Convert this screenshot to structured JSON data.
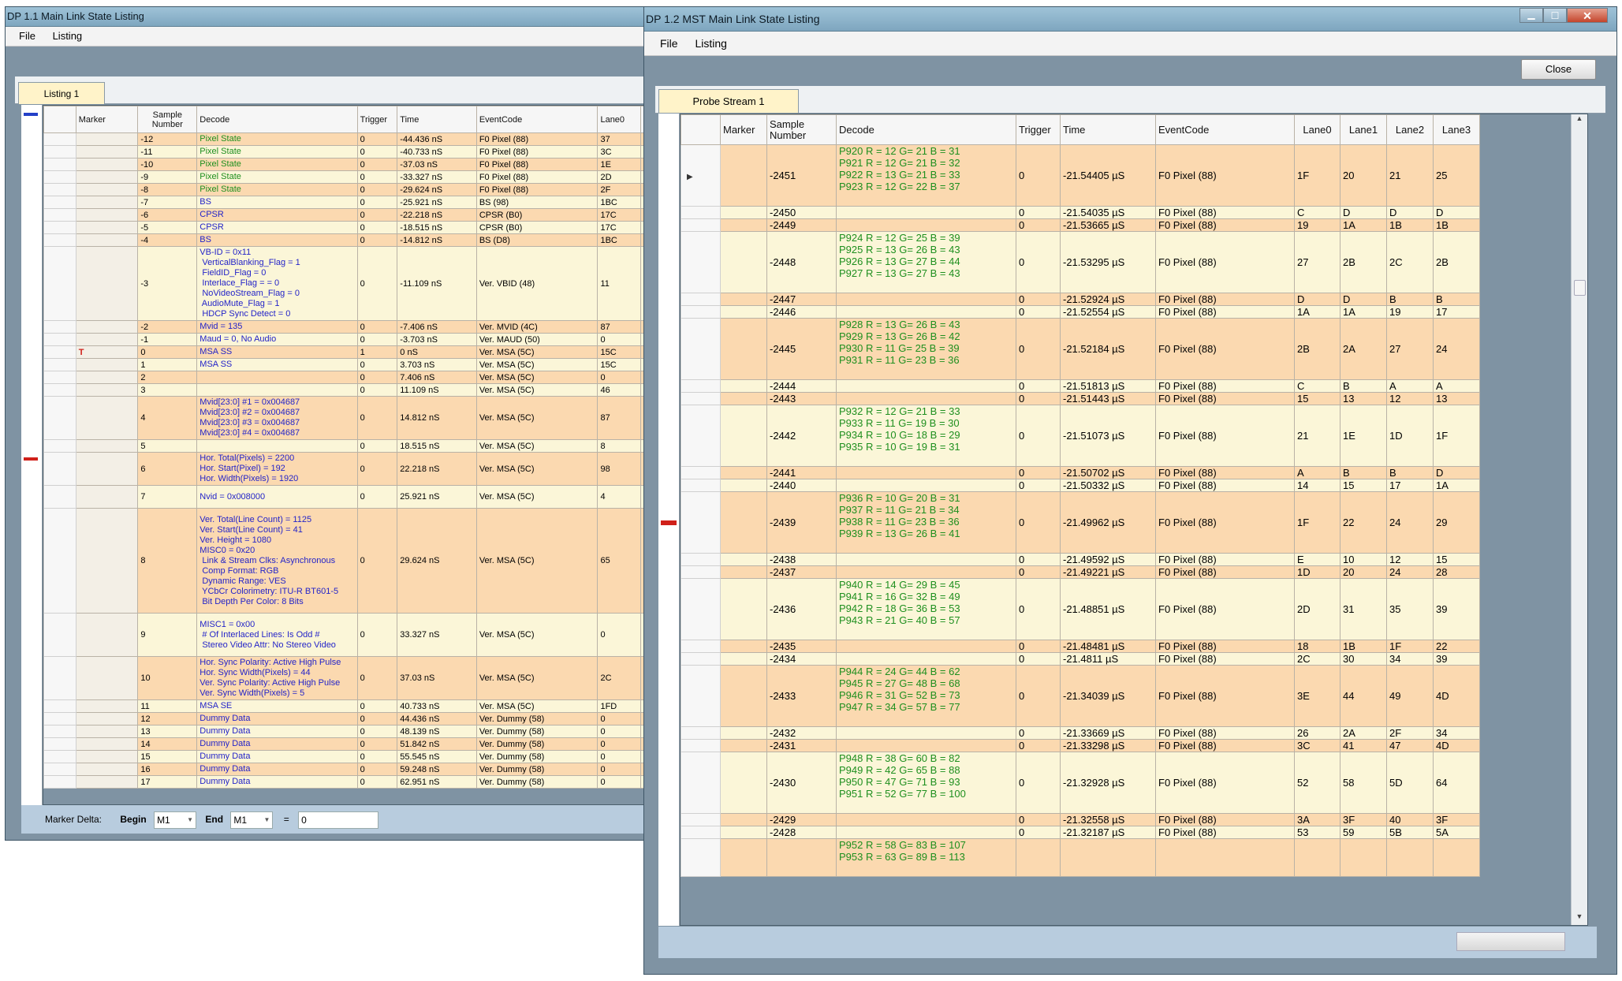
{
  "window1": {
    "title": "DP 1.1 Main Link State Listing",
    "menu": [
      "File",
      "Listing"
    ],
    "tab": "Listing 1",
    "columns": [
      "Marker",
      "Sample Number",
      "Decode",
      "Trigger",
      "Time",
      "EventCode",
      "Lane0"
    ],
    "rows": [
      {
        "marker": "",
        "sample": "-12",
        "decode": [
          "Pixel State"
        ],
        "dc": "green",
        "trigger": "0",
        "time": "-44.436 nS",
        "event": "F0 Pixel (88)",
        "lane0": "37",
        "extra": "3"
      },
      {
        "marker": "",
        "sample": "-11",
        "decode": [
          "Pixel State"
        ],
        "dc": "green",
        "trigger": "0",
        "time": "-40.733 nS",
        "event": "F0 Pixel (88)",
        "lane0": "3C",
        "extra": "3"
      },
      {
        "marker": "",
        "sample": "-10",
        "decode": [
          "Pixel State"
        ],
        "dc": "green",
        "trigger": "0",
        "time": "-37.03 nS",
        "event": "F0 Pixel (88)",
        "lane0": "1E",
        "extra": "1"
      },
      {
        "marker": "",
        "sample": "-9",
        "decode": [
          "Pixel State"
        ],
        "dc": "green",
        "trigger": "0",
        "time": "-33.327 nS",
        "event": "F0 Pixel (88)",
        "lane0": "2D",
        "extra": "2"
      },
      {
        "marker": "",
        "sample": "-8",
        "decode": [
          "Pixel State"
        ],
        "dc": "green",
        "trigger": "0",
        "time": "-29.624 nS",
        "event": "F0 Pixel (88)",
        "lane0": "2F",
        "extra": "2"
      },
      {
        "marker": "",
        "sample": "-7",
        "decode": [
          "BS"
        ],
        "dc": "blue",
        "trigger": "0",
        "time": "-25.921 nS",
        "event": "BS (98)",
        "lane0": "1BC",
        "extra": "1"
      },
      {
        "marker": "",
        "sample": "-6",
        "decode": [
          "CPSR"
        ],
        "dc": "blue",
        "trigger": "0",
        "time": "-22.218 nS",
        "event": "CPSR (B0)",
        "lane0": "17C",
        "extra": "1"
      },
      {
        "marker": "",
        "sample": "-5",
        "decode": [
          "CPSR"
        ],
        "dc": "blue",
        "trigger": "0",
        "time": "-18.515 nS",
        "event": "CPSR (B0)",
        "lane0": "17C",
        "extra": "1"
      },
      {
        "marker": "",
        "sample": "-4",
        "decode": [
          "BS"
        ],
        "dc": "blue",
        "trigger": "0",
        "time": "-14.812 nS",
        "event": "BS (D8)",
        "lane0": "1BC",
        "extra": "1"
      },
      {
        "marker": "",
        "sample": "-3",
        "decode": [
          "VB-ID = 0x11",
          " VerticalBlanking_Flag = 1",
          " FieldID_Flag = 0",
          " Interlace_Flag = = 0",
          " NoVideoStream_Flag = 0",
          " AudioMute_Flag = 1",
          " HDCP Sync Detect = 0"
        ],
        "dc": "blue",
        "trigger": "0",
        "time": "-11.109 nS",
        "event": "Ver. VBID (48)",
        "lane0": "11",
        "extra": "1"
      },
      {
        "marker": "",
        "sample": "-2",
        "decode": [
          "Mvid = 135"
        ],
        "dc": "blue",
        "trigger": "0",
        "time": "-7.406 nS",
        "event": "Ver. MVID (4C)",
        "lane0": "87",
        "extra": "8"
      },
      {
        "marker": "",
        "sample": "-1",
        "decode": [
          "Maud = 0, No Audio"
        ],
        "dc": "blue",
        "trigger": "0",
        "time": "-3.703 nS",
        "event": "Ver. MAUD (50)",
        "lane0": "0",
        "extra": "0"
      },
      {
        "marker": "T",
        "sample": "0",
        "decode": [
          "MSA SS"
        ],
        "dc": "blue",
        "trigger": "1",
        "time": "0 nS",
        "event": "Ver. MSA (5C)",
        "lane0": "15C",
        "extra": "1"
      },
      {
        "marker": "",
        "sample": "1",
        "decode": [
          "MSA SS"
        ],
        "dc": "blue",
        "trigger": "0",
        "time": "3.703 nS",
        "event": "Ver. MSA (5C)",
        "lane0": "15C",
        "extra": "1"
      },
      {
        "marker": "",
        "sample": "2",
        "decode": [
          ""
        ],
        "dc": "blue",
        "trigger": "0",
        "time": "7.406 nS",
        "event": "Ver. MSA (5C)",
        "lane0": "0",
        "extra": "0"
      },
      {
        "marker": "",
        "sample": "3",
        "decode": [
          ""
        ],
        "dc": "blue",
        "trigger": "0",
        "time": "11.109 nS",
        "event": "Ver. MSA (5C)",
        "lane0": "46",
        "extra": "4"
      },
      {
        "marker": "",
        "sample": "4",
        "decode": [
          "Mvid[23:0] #1 = 0x004687",
          "Mvid[23:0] #2 = 0x004687",
          "Mvid[23:0] #3 = 0x004687",
          "Mvid[23:0] #4 = 0x004687"
        ],
        "dc": "blue",
        "trigger": "0",
        "time": "14.812 nS",
        "event": "Ver. MSA (5C)",
        "lane0": "87",
        "extra": "8"
      },
      {
        "marker": "",
        "sample": "5",
        "decode": [
          ""
        ],
        "dc": "blue",
        "trigger": "0",
        "time": "18.515 nS",
        "event": "Ver. MSA (5C)",
        "lane0": "8",
        "extra": "0"
      },
      {
        "marker": "",
        "sample": "6",
        "decode": [
          "Hor. Total(Pixels) = 2200",
          "Hor. Start(Pixel) = 192",
          "Hor. Width(Pixels) = 1920"
        ],
        "dc": "blue",
        "trigger": "0",
        "time": "22.218 nS",
        "event": "Ver. MSA (5C)",
        "lane0": "98",
        "extra": "0"
      },
      {
        "marker": "",
        "sample": "7",
        "decode": [
          "Nvid = 0x008000",
          ""
        ],
        "dc": "blue",
        "trigger": "0",
        "time": "25.921 nS",
        "event": "Ver. MSA (5C)",
        "lane0": "4",
        "extra": "0"
      },
      {
        "marker": "",
        "sample": "8",
        "decode": [
          "Ver. Total(Line Count) = 1125",
          "Ver. Start(Line Count) = 41",
          "Ver. Height = 1080",
          "MISC0 = 0x20",
          " Link & Stream Clks: Asynchronous",
          " Comp Format: RGB",
          " Dynamic Range: VES",
          " YCbCr Colorimetry: ITU-R BT601-5",
          " Bit Depth Per Color: 8 Bits",
          ""
        ],
        "dc": "blue",
        "trigger": "0",
        "time": "29.624 nS",
        "event": "Ver. MSA (5C)",
        "lane0": "65",
        "extra": "2"
      },
      {
        "marker": "",
        "sample": "9",
        "decode": [
          "MISC1 = 0x00",
          " # Of Interlaced Lines: Is Odd #",
          " Stereo Video Attr: No Stereo Video",
          ""
        ],
        "dc": "blue",
        "trigger": "0",
        "time": "33.327 nS",
        "event": "Ver. MSA (5C)",
        "lane0": "0",
        "extra": "0"
      },
      {
        "marker": "",
        "sample": "10",
        "decode": [
          "Hor. Sync Polarity: Active High Pulse",
          "Hor. Sync Width(Pixels) = 44",
          "Ver. Sync Polarity: Active High Pulse",
          "Ver. Sync Width(Pixels) = 5"
        ],
        "dc": "blue",
        "trigger": "0",
        "time": "37.03 nS",
        "event": "Ver. MSA (5C)",
        "lane0": "2C",
        "extra": "5"
      },
      {
        "marker": "",
        "sample": "11",
        "decode": [
          "MSA SE"
        ],
        "dc": "blue",
        "trigger": "0",
        "time": "40.733 nS",
        "event": "Ver. MSA (5C)",
        "lane0": "1FD",
        "extra": "1"
      },
      {
        "marker": "",
        "sample": "12",
        "decode": [
          "Dummy Data"
        ],
        "dc": "blue",
        "trigger": "0",
        "time": "44.436 nS",
        "event": "Ver. Dummy (58)",
        "lane0": "0",
        "extra": "0"
      },
      {
        "marker": "",
        "sample": "13",
        "decode": [
          "Dummy Data"
        ],
        "dc": "blue",
        "trigger": "0",
        "time": "48.139 nS",
        "event": "Ver. Dummy (58)",
        "lane0": "0",
        "extra": "0"
      },
      {
        "marker": "",
        "sample": "14",
        "decode": [
          "Dummy Data"
        ],
        "dc": "blue",
        "trigger": "0",
        "time": "51.842 nS",
        "event": "Ver. Dummy (58)",
        "lane0": "0",
        "extra": "0"
      },
      {
        "marker": "",
        "sample": "15",
        "decode": [
          "Dummy Data"
        ],
        "dc": "blue",
        "trigger": "0",
        "time": "55.545 nS",
        "event": "Ver. Dummy (58)",
        "lane0": "0",
        "extra": "0"
      },
      {
        "marker": "",
        "sample": "16",
        "decode": [
          "Dummy Data"
        ],
        "dc": "blue",
        "trigger": "0",
        "time": "59.248 nS",
        "event": "Ver. Dummy (58)",
        "lane0": "0",
        "extra": "0"
      },
      {
        "marker": "",
        "sample": "17",
        "decode": [
          "Dummy Data"
        ],
        "dc": "blue",
        "trigger": "0",
        "time": "62.951 nS",
        "event": "Ver. Dummy (58)",
        "lane0": "0",
        "extra": "0"
      }
    ],
    "footer": {
      "marker_delta_label": "Marker Delta:",
      "begin_label": "Begin",
      "begin_value": "M1",
      "end_label": "End",
      "end_value": "M1",
      "equals": "=",
      "delta_value": "0"
    }
  },
  "window2": {
    "title": "DP 1.2 MST Main  Link State Listing",
    "menu": [
      "File",
      "Listing"
    ],
    "close_label": "Close",
    "tab": "Probe Stream 1",
    "columns": [
      "Marker",
      "Sample Number",
      "Decode",
      "Trigger",
      "Time",
      "EventCode",
      "Lane0",
      "Lane1",
      "Lane2",
      "Lane3"
    ],
    "rows": [
      {
        "sample": "-2451",
        "decode": [
          "P920 R = 12 G= 21 B = 31",
          "P921 R = 12 G= 21 B = 32",
          "P922 R = 13 G= 21 B = 33",
          "P923 R = 12 G= 22 B = 37"
        ],
        "trigger": "0",
        "time": "-21.54405 µS",
        "event": "F0 Pixel (88)",
        "l0": "1F",
        "l1": "20",
        "l2": "21",
        "l3": "25"
      },
      {
        "sample": "-2450",
        "decode": [
          ""
        ],
        "trigger": "0",
        "time": "-21.54035 µS",
        "event": "F0 Pixel (88)",
        "l0": "C",
        "l1": "D",
        "l2": "D",
        "l3": "D"
      },
      {
        "sample": "-2449",
        "decode": [
          ""
        ],
        "trigger": "0",
        "time": "-21.53665 µS",
        "event": "F0 Pixel (88)",
        "l0": "19",
        "l1": "1A",
        "l2": "1B",
        "l3": "1B"
      },
      {
        "sample": "-2448",
        "decode": [
          "P924 R = 12 G= 25 B = 39",
          "P925 R = 13 G= 26 B = 43",
          "P926 R = 13 G= 27 B = 44",
          "P927 R = 13 G= 27 B = 43"
        ],
        "trigger": "0",
        "time": "-21.53295 µS",
        "event": "F0 Pixel (88)",
        "l0": "27",
        "l1": "2B",
        "l2": "2C",
        "l3": "2B"
      },
      {
        "sample": "-2447",
        "decode": [
          ""
        ],
        "trigger": "0",
        "time": "-21.52924 µS",
        "event": "F0 Pixel (88)",
        "l0": "D",
        "l1": "D",
        "l2": "B",
        "l3": "B"
      },
      {
        "sample": "-2446",
        "decode": [
          ""
        ],
        "trigger": "0",
        "time": "-21.52554 µS",
        "event": "F0 Pixel (88)",
        "l0": "1A",
        "l1": "1A",
        "l2": "19",
        "l3": "17"
      },
      {
        "sample": "-2445",
        "decode": [
          "P928 R = 13 G= 26 B = 43",
          "P929 R = 13 G= 26 B = 42",
          "P930 R = 11 G= 25 B = 39",
          "P931 R = 11 G= 23 B = 36"
        ],
        "trigger": "0",
        "time": "-21.52184 µS",
        "event": "F0 Pixel (88)",
        "l0": "2B",
        "l1": "2A",
        "l2": "27",
        "l3": "24"
      },
      {
        "sample": "-2444",
        "decode": [
          ""
        ],
        "trigger": "0",
        "time": "-21.51813 µS",
        "event": "F0 Pixel (88)",
        "l0": "C",
        "l1": "B",
        "l2": "A",
        "l3": "A"
      },
      {
        "sample": "-2443",
        "decode": [
          ""
        ],
        "trigger": "0",
        "time": "-21.51443 µS",
        "event": "F0 Pixel (88)",
        "l0": "15",
        "l1": "13",
        "l2": "12",
        "l3": "13"
      },
      {
        "sample": "-2442",
        "decode": [
          "P932 R = 12 G= 21 B = 33",
          "P933 R = 11 G= 19 B = 30",
          "P934 R = 10 G= 18 B = 29",
          "P935 R = 10 G= 19 B = 31"
        ],
        "trigger": "0",
        "time": "-21.51073 µS",
        "event": "F0 Pixel (88)",
        "l0": "21",
        "l1": "1E",
        "l2": "1D",
        "l3": "1F"
      },
      {
        "sample": "-2441",
        "decode": [
          ""
        ],
        "trigger": "0",
        "time": "-21.50702 µS",
        "event": "F0 Pixel (88)",
        "l0": "A",
        "l1": "B",
        "l2": "B",
        "l3": "D"
      },
      {
        "sample": "-2440",
        "decode": [
          ""
        ],
        "trigger": "0",
        "time": "-21.50332 µS",
        "event": "F0 Pixel (88)",
        "l0": "14",
        "l1": "15",
        "l2": "17",
        "l3": "1A"
      },
      {
        "sample": "-2439",
        "decode": [
          "P936 R = 10 G= 20 B = 31",
          "P937 R = 11 G= 21 B = 34",
          "P938 R = 11 G= 23 B = 36",
          "P939 R = 13 G= 26 B = 41"
        ],
        "trigger": "0",
        "time": "-21.49962 µS",
        "event": "F0 Pixel (88)",
        "l0": "1F",
        "l1": "22",
        "l2": "24",
        "l3": "29"
      },
      {
        "sample": "-2438",
        "decode": [
          ""
        ],
        "trigger": "0",
        "time": "-21.49592 µS",
        "event": "F0 Pixel (88)",
        "l0": "E",
        "l1": "10",
        "l2": "12",
        "l3": "15"
      },
      {
        "sample": "-2437",
        "decode": [
          ""
        ],
        "trigger": "0",
        "time": "-21.49221 µS",
        "event": "F0 Pixel (88)",
        "l0": "1D",
        "l1": "20",
        "l2": "24",
        "l3": "28"
      },
      {
        "sample": "-2436",
        "decode": [
          "P940 R = 14 G= 29 B = 45",
          "P941 R = 16 G= 32 B = 49",
          "P942 R = 18 G= 36 B = 53",
          "P943 R = 21 G= 40 B = 57"
        ],
        "trigger": "0",
        "time": "-21.48851 µS",
        "event": "F0 Pixel (88)",
        "l0": "2D",
        "l1": "31",
        "l2": "35",
        "l3": "39"
      },
      {
        "sample": "-2435",
        "decode": [
          ""
        ],
        "trigger": "0",
        "time": "-21.48481 µS",
        "event": "F0 Pixel (88)",
        "l0": "18",
        "l1": "1B",
        "l2": "1F",
        "l3": "22"
      },
      {
        "sample": "-2434",
        "decode": [
          ""
        ],
        "trigger": "0",
        "time": "-21.4811 µS",
        "event": "F0 Pixel (88)",
        "l0": "2C",
        "l1": "30",
        "l2": "34",
        "l3": "39"
      },
      {
        "sample": "-2433",
        "decode": [
          "P944 R = 24 G= 44 B = 62",
          "P945 R = 27 G= 48 B = 68",
          "P946 R = 31 G= 52 B = 73",
          "P947 R = 34 G= 57 B = 77"
        ],
        "trigger": "0",
        "time": "-21.34039 µS",
        "event": "F0 Pixel (88)",
        "l0": "3E",
        "l1": "44",
        "l2": "49",
        "l3": "4D"
      },
      {
        "sample": "-2432",
        "decode": [
          ""
        ],
        "trigger": "0",
        "time": "-21.33669 µS",
        "event": "F0 Pixel (88)",
        "l0": "26",
        "l1": "2A",
        "l2": "2F",
        "l3": "34"
      },
      {
        "sample": "-2431",
        "decode": [
          ""
        ],
        "trigger": "0",
        "time": "-21.33298 µS",
        "event": "F0 Pixel (88)",
        "l0": "3C",
        "l1": "41",
        "l2": "47",
        "l3": "4D"
      },
      {
        "sample": "-2430",
        "decode": [
          "P948 R = 38 G= 60 B = 82",
          "P949 R = 42 G= 65 B = 88",
          "P950 R = 47 G= 71 B = 93",
          "P951 R = 52 G= 77 B = 100"
        ],
        "trigger": "0",
        "time": "-21.32928 µS",
        "event": "F0 Pixel (88)",
        "l0": "52",
        "l1": "58",
        "l2": "5D",
        "l3": "64"
      },
      {
        "sample": "-2429",
        "decode": [
          ""
        ],
        "trigger": "0",
        "time": "-21.32558 µS",
        "event": "F0 Pixel (88)",
        "l0": "3A",
        "l1": "3F",
        "l2": "40",
        "l3": "3F"
      },
      {
        "sample": "-2428",
        "decode": [
          ""
        ],
        "trigger": "0",
        "time": "-21.32187 µS",
        "event": "F0 Pixel (88)",
        "l0": "53",
        "l1": "59",
        "l2": "5B",
        "l3": "5A"
      },
      {
        "sample": "",
        "decode": [
          "P952 R = 58 G= 83 B = 107",
          "P953 R = 63 G= 89 B = 113"
        ],
        "trigger": "",
        "time": "",
        "event": "",
        "l0": "",
        "l1": "",
        "l2": "",
        "l3": ""
      }
    ]
  },
  "colors": {
    "row_orange": "#fbd9b0",
    "row_yellow": "#fbf6d8",
    "decode_blue": "#2424c8",
    "decode_green": "#1e8f1e",
    "marker_red": "#d0201a",
    "window_frame": "#7f93a3"
  },
  "icons": {
    "minimize": "minimize-icon",
    "maximize": "maximize-icon",
    "close": "close-icon",
    "current_row": "row-pointer-icon",
    "scroll_up": "scroll-up-icon",
    "scroll_down": "scroll-down-icon"
  }
}
